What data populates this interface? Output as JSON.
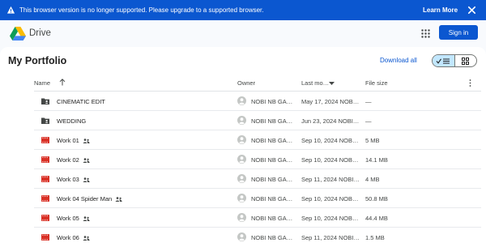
{
  "banner": {
    "message": "This browser version is no longer supported. Please upgrade to a supported browser.",
    "learn_more": "Learn More",
    "bg_color": "#0b57d0"
  },
  "header": {
    "app_name": "Drive",
    "sign_in": "Sign in",
    "icons": [
      "warning-icon",
      "close-icon",
      "drive-logo",
      "apps-grid-icon"
    ]
  },
  "folder": {
    "title": "My Portfolio",
    "download_all": "Download all",
    "view": "list"
  },
  "table": {
    "columns": {
      "name": "Name",
      "owner": "Owner",
      "modified": "Last mo…",
      "size": "File size"
    },
    "sort_icon": "arrow-up-icon",
    "rows": [
      {
        "type": "shared-folder",
        "name": "CINEMATIC EDIT",
        "shared": false,
        "owner": "NOBI NB GAMI…",
        "modified": "May 17, 2024 NOBI N…",
        "size": "—"
      },
      {
        "type": "shared-folder",
        "name": "WEDDING",
        "shared": false,
        "owner": "NOBI NB GAMI…",
        "modified": "Jun 23, 2024 NOBI …",
        "size": "—"
      },
      {
        "type": "video",
        "name": "Work 01",
        "shared": true,
        "owner": "NOBI NB GAMI…",
        "modified": "Sep 10, 2024 NOBI …",
        "size": "5 MB"
      },
      {
        "type": "video",
        "name": "Work 02",
        "shared": true,
        "owner": "NOBI NB GAMI…",
        "modified": "Sep 10, 2024 NOBI …",
        "size": "14.1 MB"
      },
      {
        "type": "video",
        "name": "Work 03",
        "shared": true,
        "owner": "NOBI NB GAMI…",
        "modified": "Sep 11, 2024 NOBI …",
        "size": "4 MB"
      },
      {
        "type": "video",
        "name": "Work 04 Spider Man",
        "shared": true,
        "owner": "NOBI NB GAMI…",
        "modified": "Sep 10, 2024 NOBI …",
        "size": "50.8 MB"
      },
      {
        "type": "video",
        "name": "Work 05",
        "shared": true,
        "owner": "NOBI NB GAMI…",
        "modified": "Sep 10, 2024 NOBI …",
        "size": "44.4 MB"
      },
      {
        "type": "video",
        "name": "Work 06",
        "shared": true,
        "owner": "NOBI NB GAMI…",
        "modified": "Sep 11, 2024 NOBI …",
        "size": "1.5 MB"
      }
    ]
  },
  "colors": {
    "accent": "#0b57d0",
    "video_icon": "#d93025",
    "folder_icon": "#444746",
    "selected_view": "#c2e7ff"
  }
}
